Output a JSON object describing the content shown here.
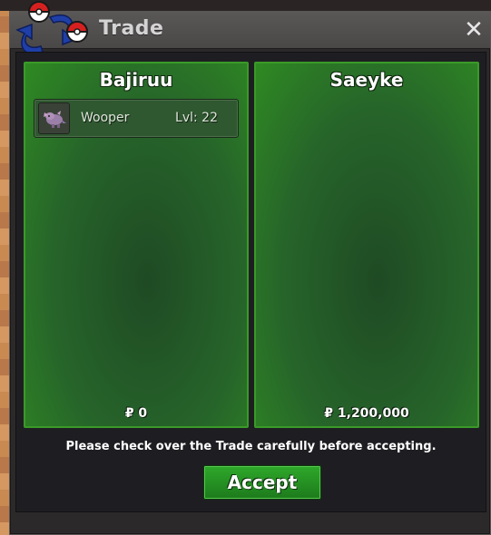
{
  "window": {
    "title": "Trade",
    "close_label": "✕"
  },
  "left_panel": {
    "name": "Bajiruu",
    "items": [
      {
        "name": "Wooper",
        "level": "Lvl: 22"
      }
    ],
    "money": "₽ 0"
  },
  "right_panel": {
    "name": "Saeyke",
    "items": [],
    "money": "₽ 1,200,000"
  },
  "notice": "Please check over the Trade carefully before accepting.",
  "accept_label": "Accept",
  "colors": {
    "panel_border": "#3a9a28",
    "panel_bg": "#26642a",
    "accept_bg": "#2ea82a",
    "window_bg": "#2c292a"
  }
}
